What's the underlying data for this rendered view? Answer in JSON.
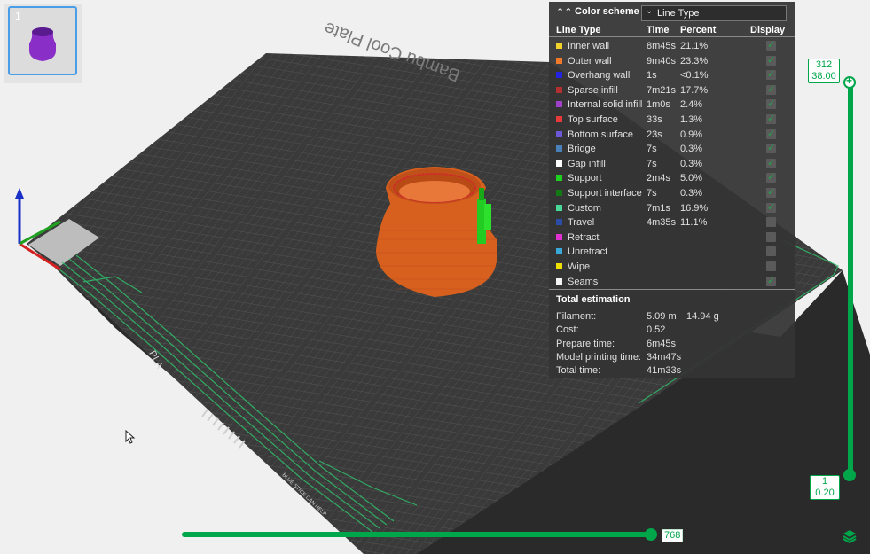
{
  "plate": {
    "name": "Bambu Cool Plate",
    "brand_mark": "PLA",
    "edge_text": "BLUE STICK CAN HELP"
  },
  "plate_list": {
    "items": [
      {
        "number": "1",
        "selected": true
      }
    ]
  },
  "legend": {
    "title": "Color scheme",
    "scheme": "Line Type",
    "headers": {
      "line_type": "Line Type",
      "time": "Time",
      "percent": "Percent",
      "display": "Display"
    },
    "rows": [
      {
        "label": "Inner wall",
        "time": "8m45s",
        "percent": "21.1%",
        "color": "#f2d22a",
        "display": true
      },
      {
        "label": "Outer wall",
        "time": "9m40s",
        "percent": "23.3%",
        "color": "#f07a2a",
        "display": true
      },
      {
        "label": "Overhang wall",
        "time": "1s",
        "percent": "<0.1%",
        "color": "#2424e0",
        "display": true
      },
      {
        "label": "Sparse infill",
        "time": "7m21s",
        "percent": "17.7%",
        "color": "#b33030",
        "display": true
      },
      {
        "label": "Internal solid infill",
        "time": "1m0s",
        "percent": "2.4%",
        "color": "#a040c8",
        "display": true
      },
      {
        "label": "Top surface",
        "time": "33s",
        "percent": "1.3%",
        "color": "#e83a3a",
        "display": true
      },
      {
        "label": "Bottom surface",
        "time": "23s",
        "percent": "0.9%",
        "color": "#6a58d8",
        "display": true
      },
      {
        "label": "Bridge",
        "time": "7s",
        "percent": "0.3%",
        "color": "#4a80b8",
        "display": true
      },
      {
        "label": "Gap infill",
        "time": "7s",
        "percent": "0.3%",
        "color": "#ffffff",
        "display": true
      },
      {
        "label": "Support",
        "time": "2m4s",
        "percent": "5.0%",
        "color": "#20d020",
        "display": true
      },
      {
        "label": "Support interface",
        "time": "7s",
        "percent": "0.3%",
        "color": "#127a12",
        "display": true
      },
      {
        "label": "Custom",
        "time": "7m1s",
        "percent": "16.9%",
        "color": "#4ad89a",
        "display": true
      },
      {
        "label": "Travel",
        "time": "4m35s",
        "percent": "11.1%",
        "color": "#2a4ea8",
        "display": false
      },
      {
        "label": "Retract",
        "time": "",
        "percent": "",
        "color": "#e030d0",
        "display": false
      },
      {
        "label": "Unretract",
        "time": "",
        "percent": "",
        "color": "#3aa8d8",
        "display": false
      },
      {
        "label": "Wipe",
        "time": "",
        "percent": "",
        "color": "#f0e000",
        "display": false
      },
      {
        "label": "Seams",
        "time": "",
        "percent": "",
        "color": "#f4f4f4",
        "display": true
      }
    ],
    "totals": {
      "title": "Total estimation",
      "rows": [
        {
          "label": "Filament:",
          "v1": "5.09 m",
          "v2": "14.94 g"
        },
        {
          "label": "Cost:",
          "v1": "0.52",
          "v2": ""
        },
        {
          "label": "Prepare time:",
          "v1": "6m45s",
          "v2": ""
        },
        {
          "label": "Model printing time:",
          "v1": "34m47s",
          "v2": ""
        },
        {
          "label": "Total time:",
          "v1": "41m33s",
          "v2": ""
        }
      ]
    }
  },
  "layer_slider": {
    "top_layer": "312",
    "top_height": "38.00",
    "bottom_layer": "1",
    "bottom_height": "0.20"
  },
  "move_slider": {
    "value": "768"
  },
  "colors": {
    "accent": "#00a64a",
    "plate": "#3b3b3b",
    "model": "#e06a28"
  },
  "icons": {
    "collapse": "chevron-up-double-icon",
    "dropdown": "chevron-down-icon",
    "layers": "layers-icon",
    "cursor": "mouse-pointer-icon"
  }
}
